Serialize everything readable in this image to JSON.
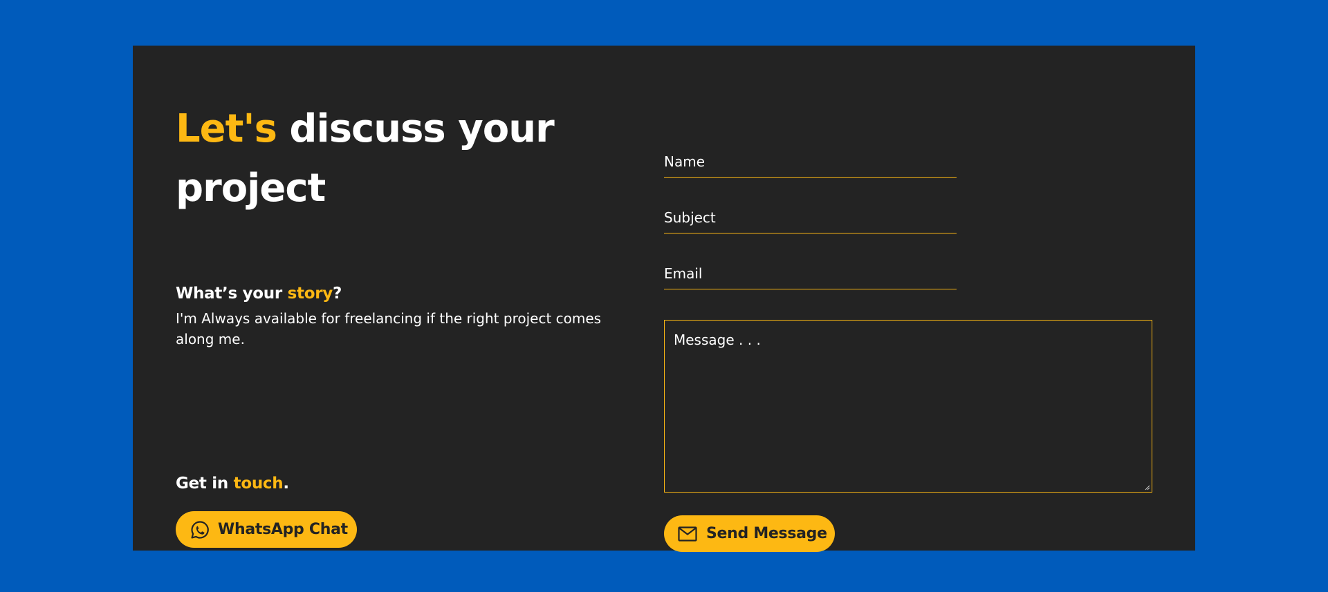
{
  "left": {
    "headline_accent": "Let's",
    "headline_rest": " discuss your project",
    "story_prefix": "What’s your ",
    "story_accent": "story",
    "story_suffix": "?",
    "story_text": "I'm Always available for freelancing if the right project comes along me.",
    "touch_prefix": "Get in ",
    "touch_accent": "touch",
    "touch_suffix": ".",
    "whatsapp_label": "WhatsApp Chat",
    "whatsapp_icon": "whatsapp-icon"
  },
  "form": {
    "name_placeholder": "Name",
    "subject_placeholder": "Subject",
    "email_placeholder": "Email",
    "message_placeholder": "Message . . .",
    "send_label": "Send Message",
    "send_icon": "envelope-icon"
  },
  "colors": {
    "background": "#005BBB",
    "card": "#232323",
    "accent": "#FDB813",
    "text": "#FFFFFF"
  }
}
